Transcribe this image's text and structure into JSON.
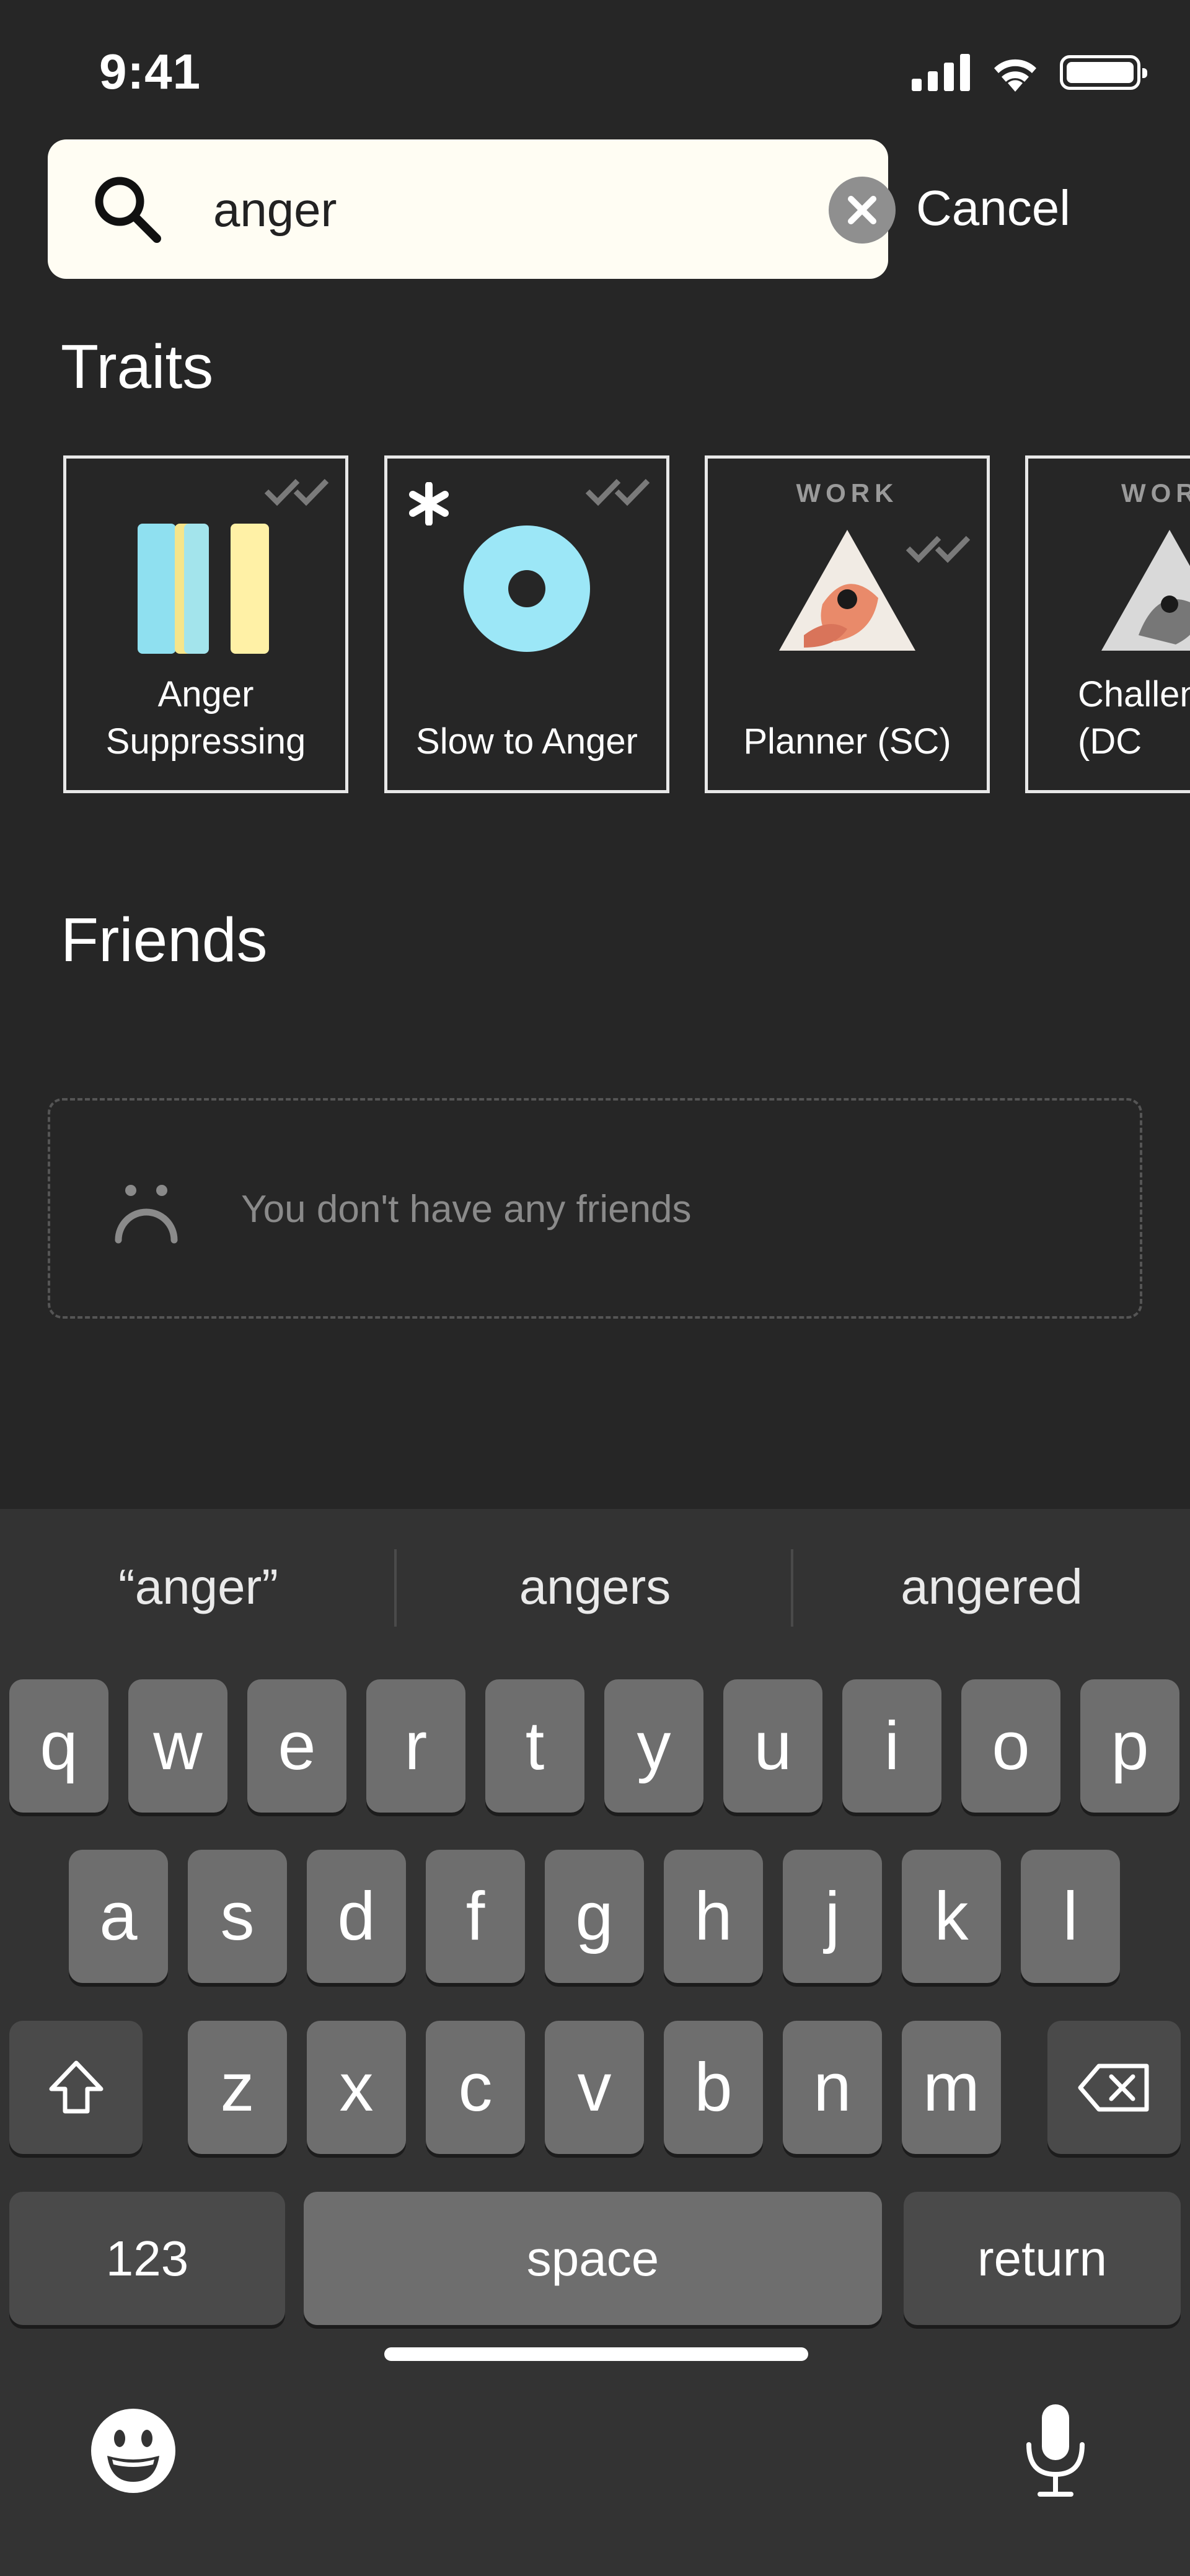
{
  "status_bar": {
    "time": "9:41"
  },
  "search": {
    "value": "anger",
    "cancel_label": "Cancel"
  },
  "traits": {
    "title": "Traits",
    "cards": [
      {
        "label": "Anger\nSuppressing",
        "tag": ""
      },
      {
        "label": "Slow to Anger",
        "tag": ""
      },
      {
        "label": "Planner (SC)",
        "tag": "WORK"
      },
      {
        "label": "Challen\n(DC",
        "tag": "WOR"
      }
    ]
  },
  "friends": {
    "title": "Friends",
    "empty_text": "You don't have any friends"
  },
  "keyboard": {
    "suggestions": [
      "“anger”",
      "angers",
      "angered"
    ],
    "row1": [
      "q",
      "w",
      "e",
      "r",
      "t",
      "y",
      "u",
      "i",
      "o",
      "p"
    ],
    "row2": [
      "a",
      "s",
      "d",
      "f",
      "g",
      "h",
      "j",
      "k",
      "l"
    ],
    "row3": [
      "z",
      "x",
      "c",
      "v",
      "b",
      "n",
      "m"
    ],
    "numbers_label": "123",
    "space_label": "space",
    "return_label": "return"
  },
  "colors": {
    "background": "#262626",
    "search_field": "#fffdf3",
    "keyboard_bg": "#333333",
    "key": "#6e6e6e",
    "key_dark": "#4a4a4a"
  }
}
